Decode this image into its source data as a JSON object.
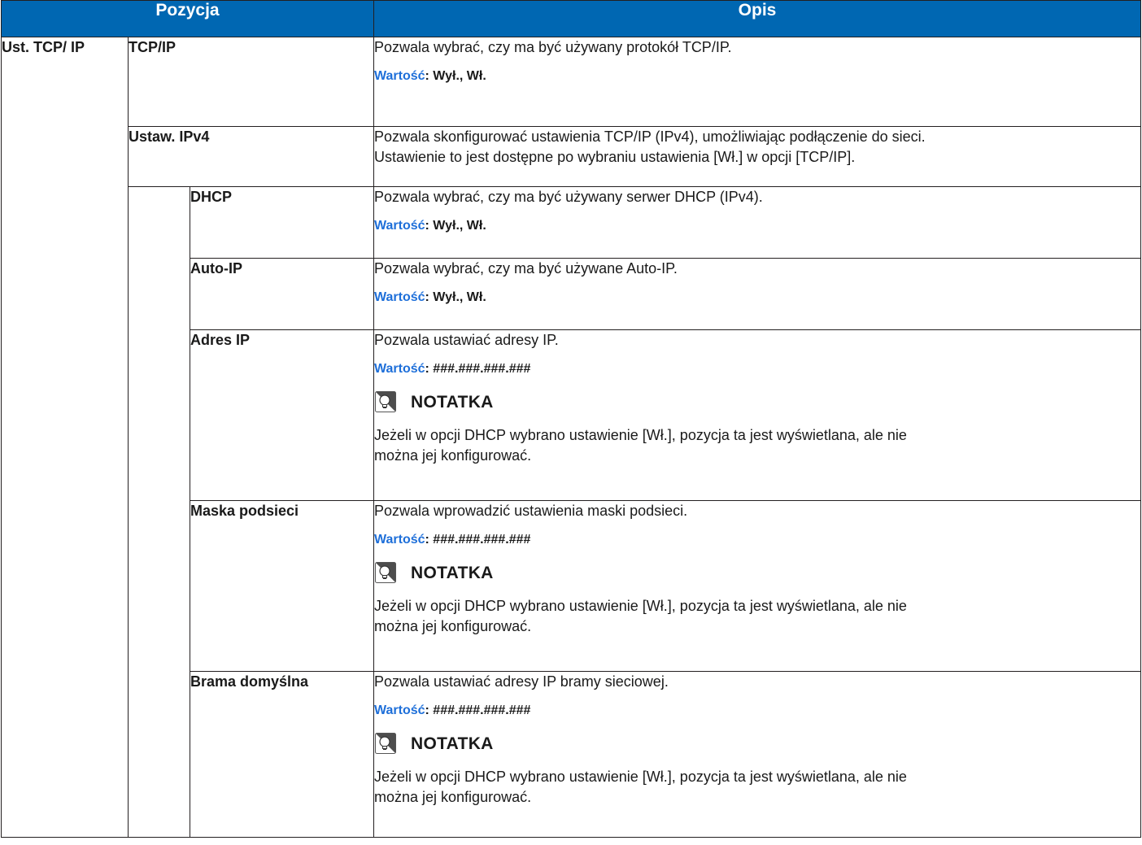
{
  "header": {
    "col_item": "Pozycja",
    "col_desc": "Opis"
  },
  "group": {
    "label": "Ust. TCP/ IP"
  },
  "value_label": "Wartość",
  "rows": [
    {
      "label": "TCP/IP",
      "lines": [
        "Pozwala wybrać, czy ma być używany protokół TCP/IP."
      ],
      "value": ": Wył., Wł."
    },
    {
      "label": "Ustaw. IPv4",
      "lines": [
        "Pozwala skonfigurować ustawienia TCP/IP (IPv4), umożliwiając podłączenie do sieci.",
        "Ustawienie to jest dostępne po wybraniu ustawienia [Wł.] w opcji [TCP/IP]."
      ]
    },
    {
      "label": "DHCP",
      "lines": [
        "Pozwala wybrać, czy ma być używany serwer DHCP (IPv4)."
      ],
      "value": ": Wył., Wł."
    },
    {
      "label": "Auto-IP",
      "lines": [
        "Pozwala wybrać, czy ma być używane Auto-IP."
      ],
      "value": ": Wył., Wł."
    },
    {
      "label": "Adres IP",
      "lines": [
        "Pozwala ustawiać adresy IP."
      ],
      "value": ": ###.###.###.###",
      "note_title": "NOTATKA",
      "note_lines": [
        "Jeżeli w opcji DHCP wybrano ustawienie [Wł.], pozycja ta jest wyświetlana, ale nie",
        "można jej konfigurować."
      ]
    },
    {
      "label": "Maska podsieci",
      "lines": [
        "Pozwala wprowadzić ustawienia maski podsieci."
      ],
      "value": ": ###.###.###.###",
      "note_title": "NOTATKA",
      "note_lines": [
        "Jeżeli w opcji DHCP wybrano ustawienie [Wł.], pozycja ta jest wyświetlana, ale nie",
        "można jej konfigurować."
      ]
    },
    {
      "label": "Brama domyślna",
      "lines": [
        "Pozwala ustawiać adresy IP bramy sieciowej."
      ],
      "value": ": ###.###.###.###",
      "note_title": "NOTATKA",
      "note_lines": [
        "Jeżeli w opcji DHCP wybrano ustawienie [Wł.], pozycja ta jest wyświetlana, ale nie",
        "można jej konfigurować."
      ]
    }
  ],
  "colors": {
    "header_bg": "#0067b2",
    "value_label": "#1e6fd9",
    "border": "#231f20"
  },
  "icons": {
    "note": "lightbulb-note-icon"
  }
}
